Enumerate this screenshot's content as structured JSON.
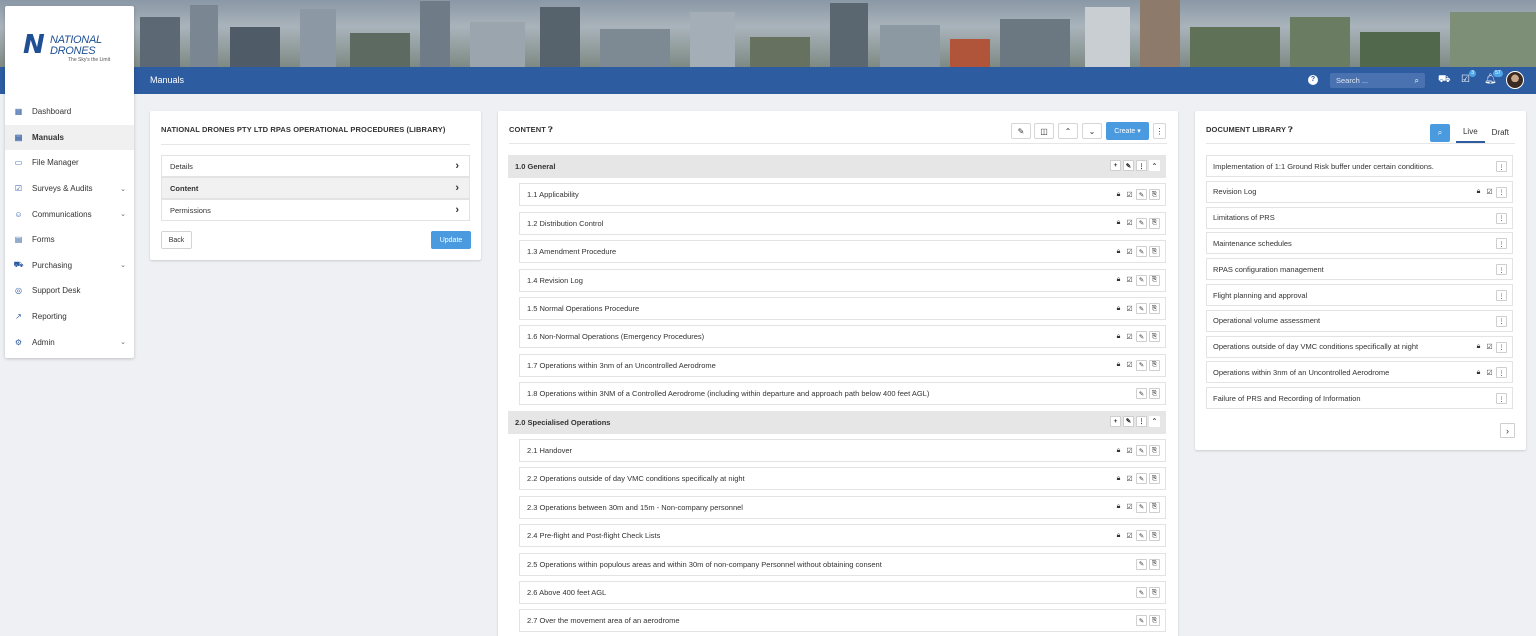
{
  "topbar": {
    "page_title": "Manuals",
    "search_placeholder": "Search ...",
    "tasks_badge": "3",
    "notifications_badge": "57"
  },
  "brand": {
    "logo_letter": "N",
    "logo_line1": "NATIONAL",
    "logo_line2": "DRONES",
    "tagline": "The Sky's the Limit"
  },
  "sidebar": {
    "items": [
      {
        "label": "Dashboard",
        "icon": "dashboard-icon",
        "glyph": "▦",
        "submenu": false
      },
      {
        "label": "Manuals",
        "icon": "manual-icon",
        "glyph": "▤",
        "submenu": false,
        "active": true
      },
      {
        "label": "File Manager",
        "icon": "folder-icon",
        "glyph": "▭",
        "submenu": false
      },
      {
        "label": "Surveys & Audits",
        "icon": "checkbox-icon",
        "glyph": "☑",
        "submenu": true
      },
      {
        "label": "Communications",
        "icon": "chat-icon",
        "glyph": "☺",
        "submenu": true
      },
      {
        "label": "Forms",
        "icon": "form-icon",
        "glyph": "▤",
        "submenu": false
      },
      {
        "label": "Purchasing",
        "icon": "cart-icon",
        "glyph": "⛟",
        "submenu": true
      },
      {
        "label": "Support Desk",
        "icon": "lifebuoy-icon",
        "glyph": "◎",
        "submenu": false
      },
      {
        "label": "Reporting",
        "icon": "chart-icon",
        "glyph": "↗",
        "submenu": false
      },
      {
        "label": "Admin",
        "icon": "cogs-icon",
        "glyph": "⚙",
        "submenu": true
      }
    ]
  },
  "manual_panel": {
    "title": "NATIONAL DRONES PTY LTD RPAS OPERATIONAL PROCEDURES (LIBRARY)",
    "menu": [
      "Details",
      "Content",
      "Permissions"
    ],
    "selected": "Content",
    "back_label": "Back",
    "update_label": "Update"
  },
  "content_panel": {
    "title": "CONTENT",
    "create_label": "Create ▾",
    "sections": [
      {
        "title": "1.0 General",
        "items": [
          {
            "label": "1.1 Applicability",
            "locked": true
          },
          {
            "label": "1.2 Distribution Control",
            "locked": true
          },
          {
            "label": "1.3 Amendment Procedure",
            "locked": true
          },
          {
            "label": "1.4 Revision Log",
            "locked": true
          },
          {
            "label": "1.5 Normal Operations Procedure",
            "locked": true
          },
          {
            "label": "1.6 Non-Normal Operations (Emergency Procedures)",
            "locked": true
          },
          {
            "label": "1.7 Operations within 3nm of an Uncontrolled Aerodrome",
            "locked": true
          },
          {
            "label": "1.8 Operations within 3NM of a Controlled Aerodrome (including within departure and approach path below 400 feet AGL)",
            "locked": false
          }
        ]
      },
      {
        "title": "2.0 Specialised Operations",
        "items": [
          {
            "label": "2.1 Handover",
            "locked": true
          },
          {
            "label": "2.2 Operations outside of day VMC conditions specifically at night",
            "locked": true
          },
          {
            "label": "2.3 Operations between 30m and 15m - Non-company personnel",
            "locked": true
          },
          {
            "label": "2.4 Pre-flight and Post-flight Check Lists",
            "locked": true
          },
          {
            "label": "2.5 Operations within populous areas and within 30m of non-company Personnel without obtaining consent",
            "locked": false
          },
          {
            "label": "2.6 Above 400 feet AGL",
            "locked": false
          },
          {
            "label": "2.7 Over the movement area of an aerodrome",
            "locked": false
          }
        ]
      }
    ]
  },
  "library_panel": {
    "title": "DOCUMENT LIBRARY",
    "tabs": [
      "Live",
      "Draft"
    ],
    "active_tab": "Live",
    "documents": [
      {
        "label": "Implementation of 1:1 Ground Risk buffer under certain conditions.",
        "locked": false
      },
      {
        "label": "Revision Log",
        "locked": true
      },
      {
        "label": "Limitations of PRS",
        "locked": false
      },
      {
        "label": "Maintenance schedules",
        "locked": false
      },
      {
        "label": "RPAS configuration management",
        "locked": false
      },
      {
        "label": "Flight planning and approval",
        "locked": false
      },
      {
        "label": "Operational volume assessment",
        "locked": false
      },
      {
        "label": "Operations outside of day VMC conditions specifically at night",
        "locked": true
      },
      {
        "label": "Operations within 3nm of an Uncontrolled Aerodrome",
        "locked": true
      },
      {
        "label": "Failure of PRS and Recording of Information",
        "locked": false
      }
    ]
  },
  "colors": {
    "topbar": "#2e5ca1",
    "primary_button": "#4a9ae0",
    "page_bg": "#eef0f3"
  }
}
